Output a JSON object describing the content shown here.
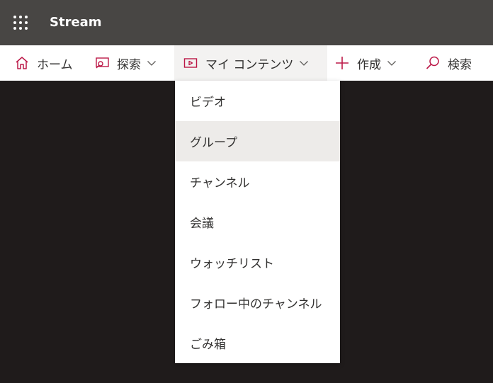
{
  "app": {
    "title": "Stream"
  },
  "nav": {
    "home_label": "ホーム",
    "explore_label": "探索",
    "mycontent_label": "マイ コンテンツ",
    "create_label": "作成",
    "search_label": "検索"
  },
  "dropdown": {
    "items": [
      {
        "label": "ビデオ"
      },
      {
        "label": "グループ"
      },
      {
        "label": "チャンネル"
      },
      {
        "label": "会議"
      },
      {
        "label": "ウォッチリスト"
      },
      {
        "label": "フォロー中のチャンネル"
      },
      {
        "label": "ごみ箱"
      }
    ],
    "hovered_item": "グループ"
  },
  "colors": {
    "topbar_bg": "#484644",
    "accent": "#bc1948",
    "background": "#1f1b1b",
    "menu_hover": "#edebe9"
  },
  "icons": {
    "waffle": "app-launcher-icon",
    "home": "home-icon",
    "explore": "explore-icon",
    "mycontent": "video-icon",
    "create": "plus-icon",
    "search": "search-icon",
    "chevron": "chevron-down-icon"
  }
}
